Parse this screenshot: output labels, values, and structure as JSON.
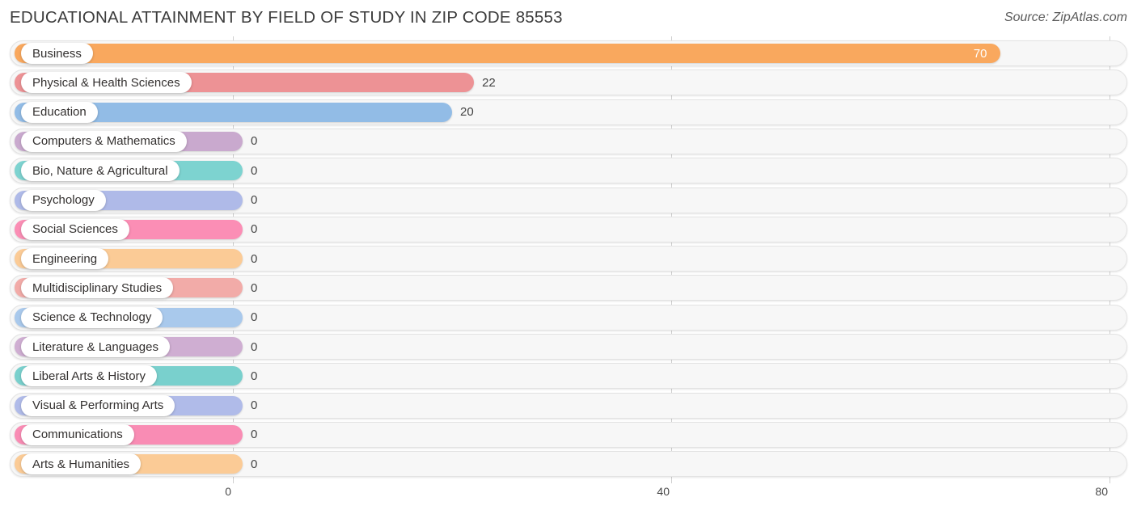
{
  "header": {
    "title": "EDUCATIONAL ATTAINMENT BY FIELD OF STUDY IN ZIP CODE 85553",
    "source": "Source: ZipAtlas.com"
  },
  "chart_data": {
    "type": "bar",
    "orientation": "horizontal",
    "title": "EDUCATIONAL ATTAINMENT BY FIELD OF STUDY IN ZIP CODE 85553",
    "xlabel": "",
    "ylabel": "",
    "xlim": [
      0,
      80
    ],
    "xticks": [
      0,
      40,
      80
    ],
    "xtick_labels": [
      "0",
      "40",
      "80"
    ],
    "grid": true,
    "legend": "none",
    "categories": [
      "Business",
      "Physical & Health Sciences",
      "Education",
      "Computers & Mathematics",
      "Bio, Nature & Agricultural",
      "Psychology",
      "Social Sciences",
      "Engineering",
      "Multidisciplinary Studies",
      "Science & Technology",
      "Literature & Languages",
      "Liberal Arts & History",
      "Visual & Performing Arts",
      "Communications",
      "Arts & Humanities"
    ],
    "values": [
      70,
      22,
      20,
      0,
      0,
      0,
      0,
      0,
      0,
      0,
      0,
      0,
      0,
      0,
      0
    ],
    "value_labels": [
      "70",
      "22",
      "20",
      "0",
      "0",
      "0",
      "0",
      "0",
      "0",
      "0",
      "0",
      "0",
      "0",
      "0",
      "0"
    ],
    "colors": [
      "#f9a85e",
      "#ed9295",
      "#92bce6",
      "#c9a9ce",
      "#7dd3d0",
      "#afbae8",
      "#fb8eb5",
      "#fbcb96",
      "#f2aba8",
      "#a9c9ec",
      "#cfaed2",
      "#79d0cd",
      "#b0bbe9",
      "#f98cb4",
      "#fbcb96"
    ]
  },
  "axis": {
    "ticks": [
      {
        "label": "0",
        "value": 0
      },
      {
        "label": "40",
        "value": 40
      },
      {
        "label": "80",
        "value": 80
      }
    ]
  }
}
